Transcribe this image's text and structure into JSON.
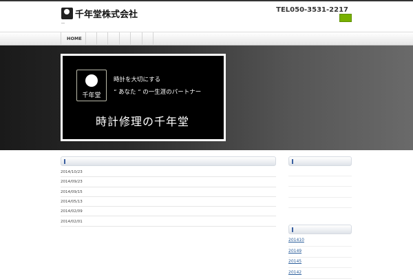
{
  "header": {
    "company": "千年堂株式会社",
    "tagline": "--",
    "tel": "TEL050-3531-2217"
  },
  "nav": {
    "items": [
      "HOME",
      "",
      "",
      "",
      "",
      "",
      ""
    ]
  },
  "banner": {
    "line1": "時計を大切にする",
    "line2": "“ あなた ” の一生涯のパートナー",
    "title": "時計修理の千年堂",
    "icon_label": "千年堂"
  },
  "news": {
    "dates": [
      "2014/10/23",
      "2014/09/23",
      "2014/09/15",
      "2014/05/13",
      "2014/02/09",
      "2014/02/01"
    ]
  },
  "archives": {
    "links": [
      "201410",
      "20149",
      "20145",
      "20142"
    ]
  },
  "colors": {
    "accent": "#77b000",
    "link": "#2a5d9a"
  }
}
